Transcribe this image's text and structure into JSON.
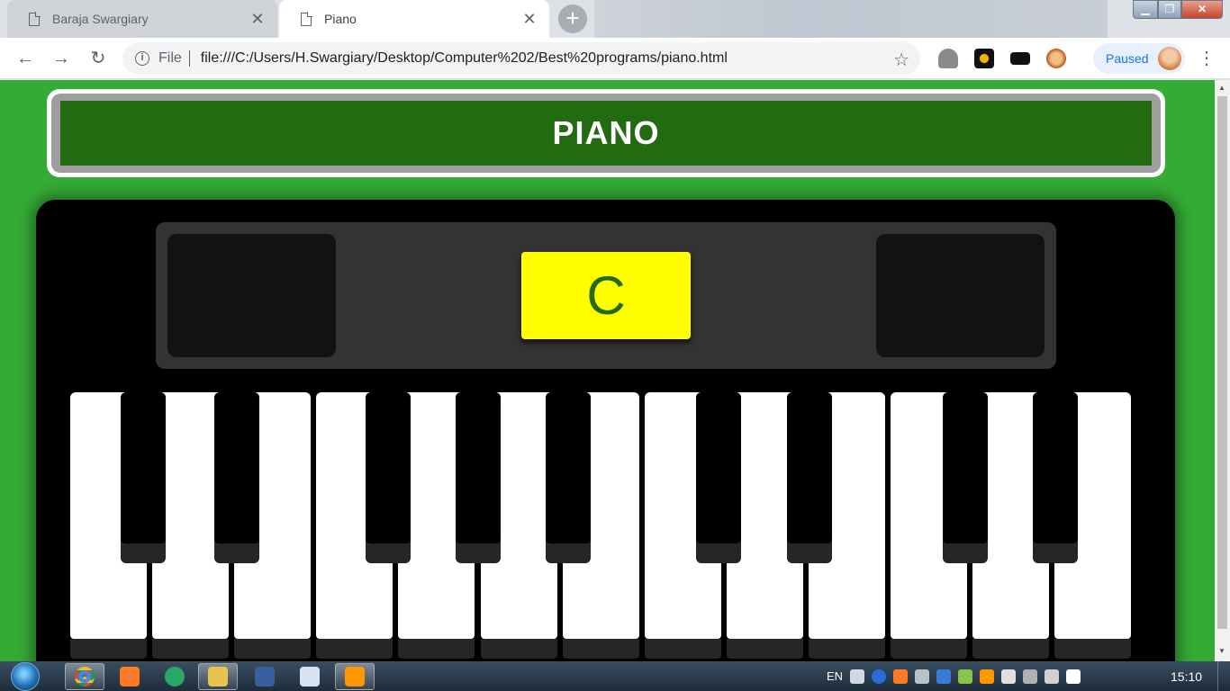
{
  "browser": {
    "tabs": [
      {
        "title": "Baraja Swargiary",
        "active": false
      },
      {
        "title": "Piano",
        "active": true
      }
    ],
    "address": {
      "scheme_label": "File",
      "url": "file:///C:/Users/H.Swargiary/Desktop/Computer%202/Best%20programs/piano.html"
    },
    "profile_status": "Paused",
    "icons": {
      "back": "back-arrow-icon",
      "forward": "forward-arrow-icon",
      "reload": "reload-icon",
      "info": "info-icon",
      "bookmark": "star-icon",
      "close_tab": "close-icon",
      "new_tab": "plus-icon",
      "menu": "kebab-menu-icon"
    }
  },
  "page": {
    "title": "PIANO",
    "display_note": "C",
    "colors": {
      "background": "#34ab34",
      "title_bar": "#226b11",
      "display": "#ffff00",
      "display_text": "#226b11"
    },
    "white_keys_count": 13,
    "black_keys_count": 9
  },
  "taskbar": {
    "language": "EN",
    "time": "15:10"
  }
}
